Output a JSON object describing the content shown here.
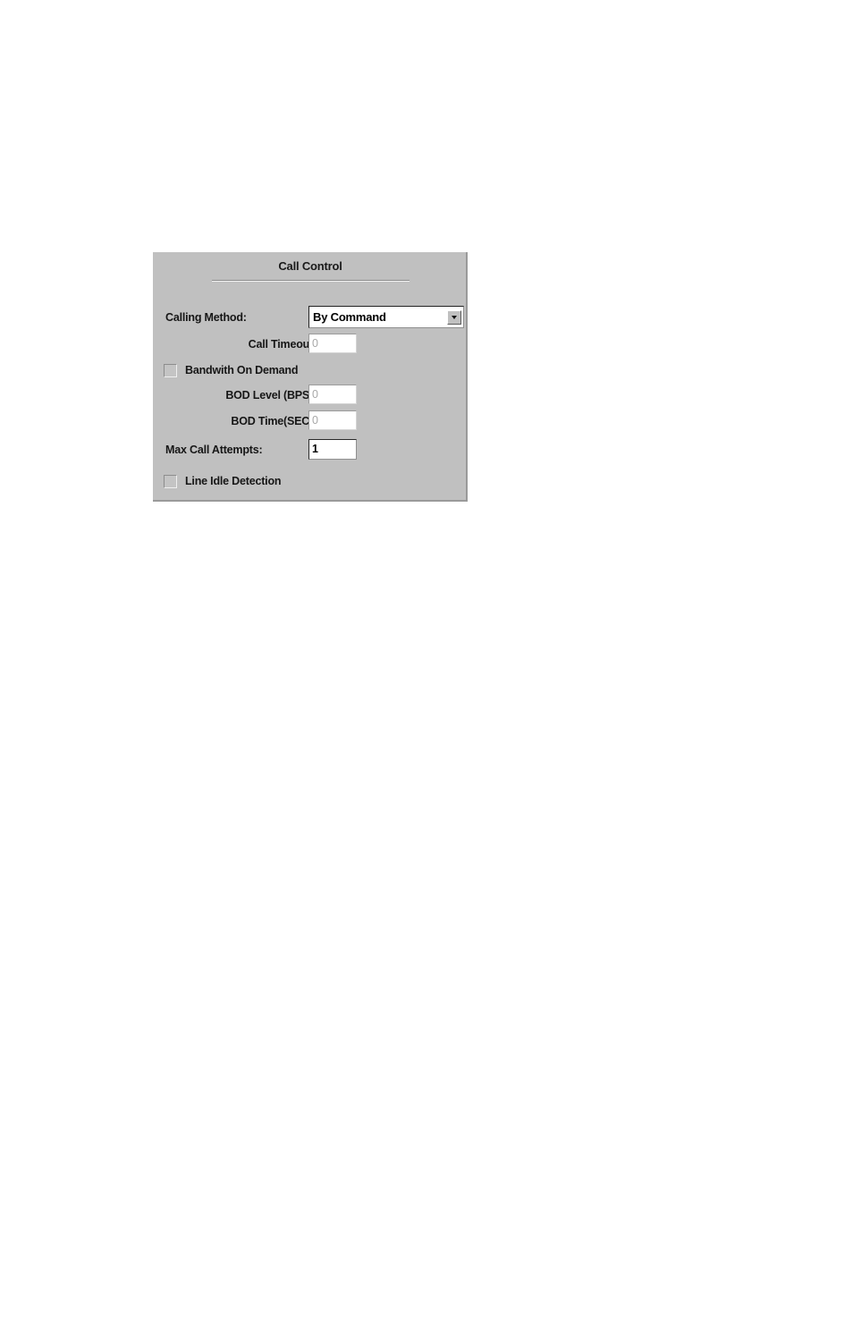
{
  "panel": {
    "title": "Call Control",
    "rows": {
      "calling_method": {
        "label": "Calling Method:",
        "value": "By Command",
        "options": [
          "By Command"
        ],
        "dropdown_icon": "chevron-down-icon"
      },
      "call_timeout": {
        "label": "Call Timeout:",
        "value": "0",
        "enabled": false
      },
      "bandwith_on_demand": {
        "label": "Bandwith On Demand",
        "checked": false,
        "enabled": false
      },
      "bod_level": {
        "label": "BOD Level (BPS):",
        "value": "0",
        "enabled": false
      },
      "bod_time": {
        "label": "BOD Time(SEC):",
        "value": "0",
        "enabled": false
      },
      "max_call_attempts": {
        "label": "Max Call Attempts:",
        "value": "1",
        "enabled": true
      },
      "line_idle_detection": {
        "label": "Line Idle Detection",
        "checked": false,
        "enabled": false
      }
    }
  },
  "colors": {
    "page_background": "#ffffff",
    "panel_face": "#c0c0c0",
    "panel_shadow": "#9a9a9a",
    "field_background": "#ffffff",
    "text": "#161616",
    "disabled_text": "#a8a8a8",
    "enabled_border": "#2a2a2a",
    "disabled_border": "#9b9b9b"
  }
}
